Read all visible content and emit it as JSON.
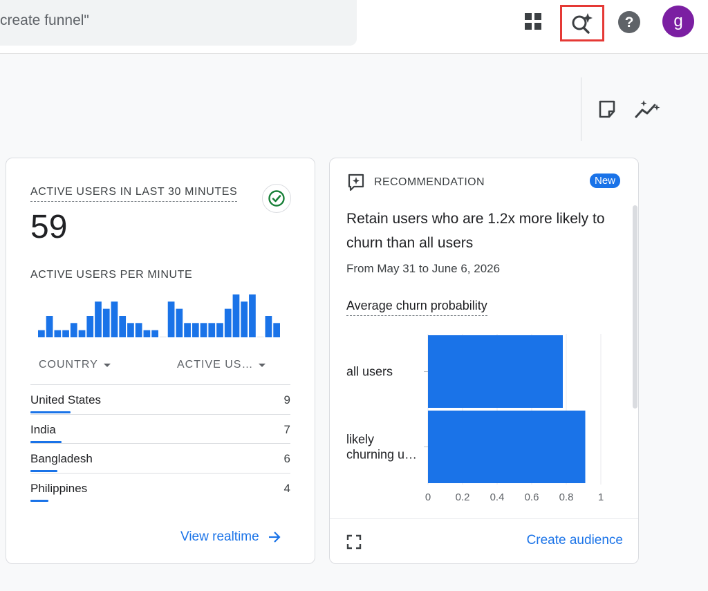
{
  "topbar": {
    "search_text": "create funnel\"",
    "avatar_letter": "g",
    "insights_highlight_color": "#e53935"
  },
  "realtime": {
    "title": "ACTIVE USERS IN LAST 30 MINUTES",
    "total": "59",
    "per_minute_label": "ACTIVE USERS PER MINUTE",
    "per_minute_values": [
      1,
      3,
      1,
      1,
      2,
      1,
      3,
      5,
      4,
      5,
      3,
      2,
      2,
      1,
      1,
      0,
      5,
      4,
      2,
      2,
      2,
      2,
      2,
      4,
      6,
      5,
      6,
      0,
      3,
      2
    ],
    "col_country": "COUNTRY",
    "col_users": "ACTIVE US…",
    "rows": [
      {
        "country": "United States",
        "users": "9",
        "share": 0.155
      },
      {
        "country": "India",
        "users": "7",
        "share": 0.12
      },
      {
        "country": "Bangladesh",
        "users": "6",
        "share": 0.105
      },
      {
        "country": "Philippines",
        "users": "4",
        "share": 0.068
      }
    ],
    "view_link": "View realtime"
  },
  "recommendation": {
    "label": "RECOMMENDATION",
    "badge": "New",
    "title": "Retain users who are 1.2x more likely to churn than all users",
    "date_range": "From May 31 to June 6, 2026",
    "metric_label": "Average churn probability",
    "create_link": "Create audience"
  },
  "chart_data": {
    "type": "bar",
    "orientation": "horizontal",
    "title": "Average churn probability",
    "categories": [
      "all users",
      "likely churning u…"
    ],
    "values": [
      0.78,
      0.91
    ],
    "xlim": [
      0,
      1
    ],
    "ticks": [
      "0",
      "0.2",
      "0.4",
      "0.6",
      "0.8",
      "1"
    ],
    "grid": true,
    "color": "#1a73e8"
  }
}
